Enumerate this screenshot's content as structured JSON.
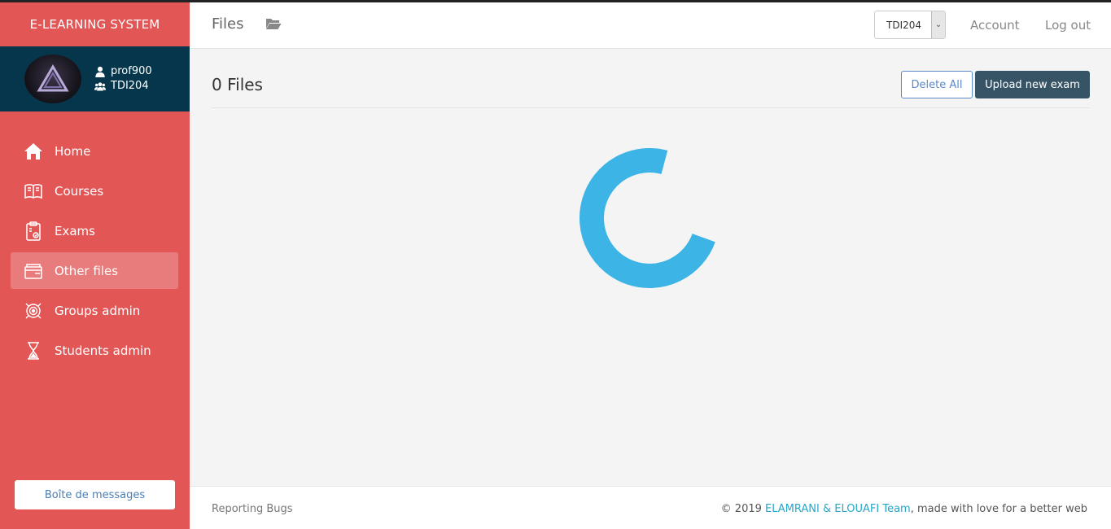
{
  "sidebar": {
    "brand": "E-LEARNING SYSTEM",
    "user": {
      "name": "prof900",
      "group": "TDI204"
    },
    "items": [
      {
        "label": "Home",
        "icon": "home-icon",
        "active": false
      },
      {
        "label": "Courses",
        "icon": "book-icon",
        "active": false
      },
      {
        "label": "Exams",
        "icon": "exam-clipboard-icon",
        "active": false
      },
      {
        "label": "Other files",
        "icon": "files-icon",
        "active": true
      },
      {
        "label": "Groups admin",
        "icon": "groups-target-icon",
        "active": false
      },
      {
        "label": "Students admin",
        "icon": "students-hourglass-icon",
        "active": false
      }
    ],
    "message_button": "Boîte de messages"
  },
  "header": {
    "title": "Files",
    "group_select": {
      "value": "TDI204"
    },
    "account_link": "Account",
    "logout_link": "Log out"
  },
  "main": {
    "files_count": "0 Files",
    "delete_all": "Delete All",
    "upload": "Upload new exam",
    "spinner_color": "#3cb4e6"
  },
  "footer": {
    "report": "Reporting Bugs",
    "copyright_prefix": "© 2019 ",
    "team": "ELAMRANI & ELOUAFI Team",
    "copyright_suffix": ", made with love for a better web"
  },
  "colors": {
    "sidebar": "#e25656",
    "userbox": "#06364b",
    "upload_button": "#365466",
    "link": "#27a6c8"
  }
}
